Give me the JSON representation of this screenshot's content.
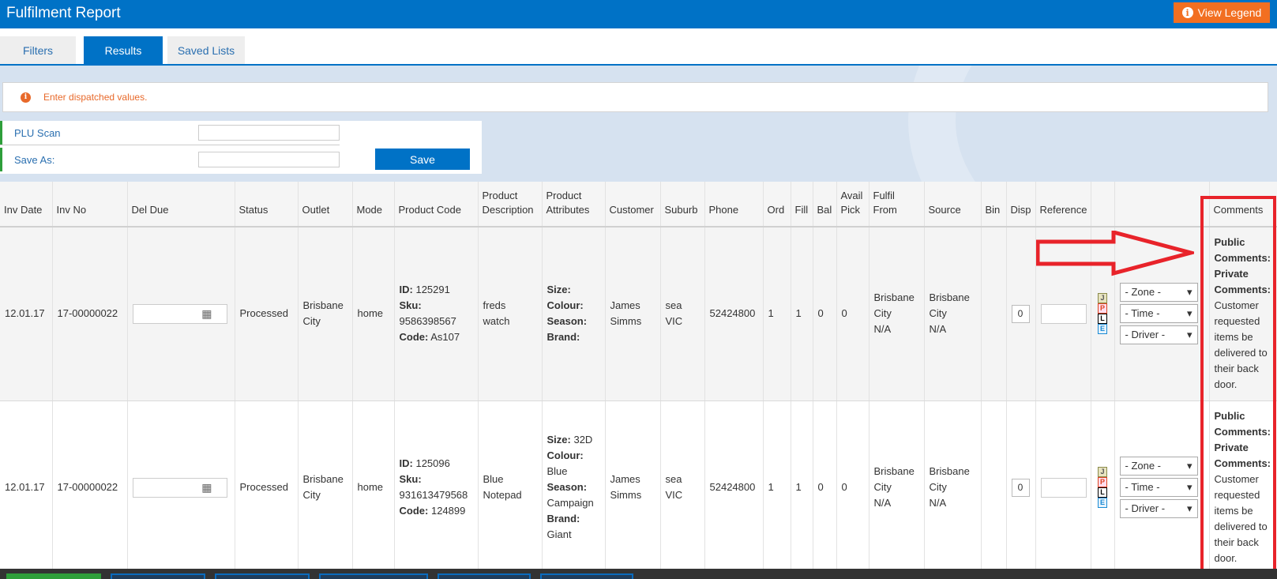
{
  "header": {
    "title": "Fulfilment Report",
    "legend_button": "View Legend"
  },
  "tabs": [
    {
      "label": "Filters",
      "active": false
    },
    {
      "label": "Results",
      "active": true
    },
    {
      "label": "Saved Lists",
      "active": false
    }
  ],
  "alert": {
    "text": "Enter dispatched values."
  },
  "form": {
    "plu_label": "PLU Scan",
    "save_as_label": "Save As:",
    "save_button": "Save"
  },
  "table": {
    "columns": [
      "Inv Date",
      "Inv No",
      "Del Due",
      "Status",
      "Outlet",
      "Mode",
      "Product Code",
      "Product Description",
      "Product Attributes",
      "Customer",
      "Suburb",
      "Phone",
      "Ord",
      "Fill",
      "Bal",
      "Avail Pick",
      "Fulfil From",
      "Source",
      "Bin",
      "Disp",
      "Reference",
      "",
      "",
      "Comments"
    ],
    "rows": [
      {
        "inv_date": "12.01.17",
        "inv_no": "17-00000022",
        "status": "Processed",
        "outlet_1": "Brisbane",
        "outlet_2": "City",
        "mode": "home",
        "id_label": "ID:",
        "id": "125291",
        "sku_label": "Sku:",
        "sku": "9586398567",
        "code_label": "Code:",
        "code": "As107",
        "desc_1": "freds",
        "desc_2": "watch",
        "size_label": "Size:",
        "size": "",
        "colour_label": "Colour:",
        "colour": "",
        "season_label": "Season:",
        "season": "",
        "brand_label": "Brand:",
        "brand": "",
        "cust_1": "James",
        "cust_2": "Simms",
        "suburb_1": "sea",
        "suburb_2": "VIC",
        "phone": "52424800",
        "ord": "1",
        "fill": "1",
        "bal": "0",
        "avail": "0",
        "ff_1": "Brisbane",
        "ff_2": "City",
        "ff_3": "N/A",
        "src_1": "Brisbane",
        "src_2": "City",
        "src_3": "N/A",
        "disp": "0",
        "zone": "- Zone -",
        "time": "- Time -",
        "driver": "- Driver -",
        "pub_1": "Public",
        "pub_2": "Comments:",
        "priv_1": "Private",
        "priv_2": "Comments:",
        "c1": "Customer",
        "c2": "requested",
        "c3": "items be",
        "c4": "delivered to",
        "c5": "their back",
        "c6": "door."
      },
      {
        "inv_date": "12.01.17",
        "inv_no": "17-00000022",
        "status": "Processed",
        "outlet_1": "Brisbane",
        "outlet_2": "City",
        "mode": "home",
        "id_label": "ID:",
        "id": "125096",
        "sku_label": "Sku:",
        "sku": "931613479568",
        "code_label": "Code:",
        "code": "124899",
        "desc_1": "Blue",
        "desc_2": "Notepad",
        "size_label": "Size:",
        "size": "32D",
        "colour_label": "Colour:",
        "colour": "Blue",
        "season_label": "Season:",
        "season": "Campaign",
        "brand_label": "Brand:",
        "brand": "Giant",
        "cust_1": "James",
        "cust_2": "Simms",
        "suburb_1": "sea",
        "suburb_2": "VIC",
        "phone": "52424800",
        "ord": "1",
        "fill": "1",
        "bal": "0",
        "avail": "0",
        "ff_1": "Brisbane",
        "ff_2": "City",
        "ff_3": "N/A",
        "src_1": "Brisbane",
        "src_2": "City",
        "src_3": "N/A",
        "disp": "0",
        "zone": "- Zone -",
        "time": "- Time -",
        "driver": "- Driver -",
        "pub_1": "Public",
        "pub_2": "Comments:",
        "priv_1": "Private",
        "priv_2": "Comments:",
        "c1": "Customer",
        "c2": "requested",
        "c3": "items be",
        "c4": "delivered to",
        "c5": "their back",
        "c6": "door."
      }
    ]
  },
  "icons": {
    "legend": "info-icon",
    "calendar": "calendar-icon",
    "caret": "caret-down-icon",
    "alert": "info-icon"
  },
  "letter_icons": [
    "J",
    "P",
    "L",
    "E"
  ],
  "colors": {
    "primary": "#0072c6",
    "accent": "#f26f21",
    "alert_text": "#e8692a",
    "annotation": "#e8232a",
    "form_marker": "#2e9e3a"
  }
}
